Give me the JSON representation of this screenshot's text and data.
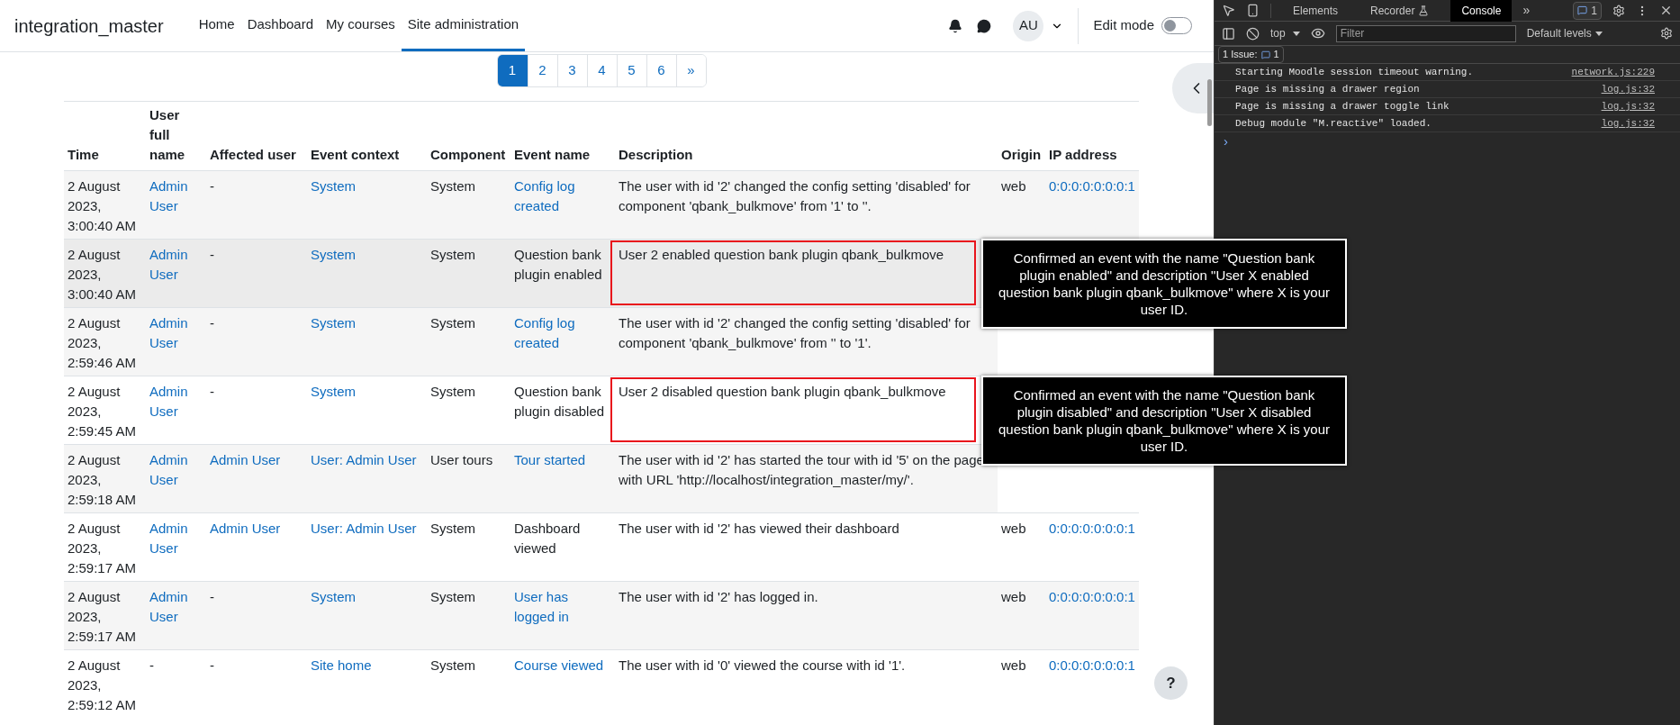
{
  "navbar": {
    "brand": "integration_master",
    "links": [
      {
        "label": "Home",
        "selected": false
      },
      {
        "label": "Dashboard",
        "selected": false
      },
      {
        "label": "My courses",
        "selected": false
      },
      {
        "label": "Site administration",
        "selected": true
      }
    ],
    "avatar": "AU",
    "edit_mode": {
      "label": "Edit mode",
      "on": false
    }
  },
  "pagination": [
    {
      "label": "1",
      "selected": true
    },
    {
      "label": "2",
      "selected": false
    },
    {
      "label": "3",
      "selected": false
    },
    {
      "label": "4",
      "selected": false
    },
    {
      "label": "5",
      "selected": false
    },
    {
      "label": "6",
      "selected": false
    },
    {
      "label": "»",
      "selected": false
    }
  ],
  "table": {
    "columns": [
      "Time",
      "User full name",
      "Affected user",
      "Event context",
      "Component",
      "Event name",
      "Description",
      "Origin",
      "IP address"
    ],
    "rows": [
      {
        "highlighted": false,
        "cells": [
          {
            "text": "2 August 2023, 3:00:40 AM",
            "link": false
          },
          {
            "text": "Admin User",
            "link": true
          },
          {
            "text": "-",
            "link": false
          },
          {
            "text": "System",
            "link": true
          },
          {
            "text": "System",
            "link": false
          },
          {
            "text": "Config log created",
            "link": true
          },
          {
            "text": "The user with id '2' changed the config setting 'disabled' for component 'qbank_bulkmove' from '1' to ''.",
            "link": false
          },
          {
            "text": "web",
            "link": false
          },
          {
            "text": "0:0:0:0:0:0:0:1",
            "link": true
          }
        ]
      },
      {
        "highlighted": true,
        "outlined": true,
        "callout": "Confirmed an event with the name \"Question bank plugin enabled\" and description \"User X enabled question bank plugin qbank_bulkmove\" where X is your user ID.",
        "cells": [
          {
            "text": "2 August 2023, 3:00:40 AM",
            "link": false
          },
          {
            "text": "Admin User",
            "link": true
          },
          {
            "text": "-",
            "link": false
          },
          {
            "text": "System",
            "link": true
          },
          {
            "text": "System",
            "link": false
          },
          {
            "text": "Question bank plugin enabled",
            "link": false
          },
          {
            "text": "User 2 enabled question bank plugin qbank_bulkmove",
            "link": false
          }
        ]
      },
      {
        "highlighted": false,
        "cells": [
          {
            "text": "2 August 2023, 2:59:46 AM",
            "link": false
          },
          {
            "text": "Admin User",
            "link": true
          },
          {
            "text": "-",
            "link": false
          },
          {
            "text": "System",
            "link": true
          },
          {
            "text": "System",
            "link": false
          },
          {
            "text": "Config log created",
            "link": true
          },
          {
            "text": "The user with id '2' changed the config setting 'disabled' for component 'qbank_bulkmove' from '' to '1'.",
            "link": false
          }
        ]
      },
      {
        "highlighted": false,
        "outlined": true,
        "callout": "Confirmed an event with the name \"Question bank plugin disabled\" and description \"User X disabled question bank plugin qbank_bulkmove\" where X is your user ID.",
        "cells": [
          {
            "text": "2 August 2023, 2:59:45 AM",
            "link": false
          },
          {
            "text": "Admin User",
            "link": true
          },
          {
            "text": "-",
            "link": false
          },
          {
            "text": "System",
            "link": true
          },
          {
            "text": "System",
            "link": false
          },
          {
            "text": "Question bank plugin disabled",
            "link": false
          },
          {
            "text": "User 2 disabled question bank plugin qbank_bulkmove",
            "link": false
          }
        ]
      },
      {
        "highlighted": false,
        "cells": [
          {
            "text": "2 August 2023, 2:59:18 AM",
            "link": false
          },
          {
            "text": "Admin User",
            "link": true
          },
          {
            "text": "Admin User",
            "link": true
          },
          {
            "text": "User: Admin User",
            "link": true
          },
          {
            "text": "User tours",
            "link": false
          },
          {
            "text": "Tour started",
            "link": true
          },
          {
            "text": "The user with id '2' has started the tour with id '5' on the page with URL 'http://localhost/integration_master/my/'.",
            "link": false
          }
        ]
      },
      {
        "highlighted": false,
        "cells": [
          {
            "text": "2 August 2023, 2:59:17 AM",
            "link": false
          },
          {
            "text": "Admin User",
            "link": true
          },
          {
            "text": "Admin User",
            "link": true
          },
          {
            "text": "User: Admin User",
            "link": true
          },
          {
            "text": "System",
            "link": false
          },
          {
            "text": "Dashboard viewed",
            "link": false
          },
          {
            "text": "The user with id '2' has viewed their dashboard",
            "link": false
          },
          {
            "text": "web",
            "link": false
          },
          {
            "text": "0:0:0:0:0:0:0:1",
            "link": true
          }
        ]
      },
      {
        "highlighted": false,
        "cells": [
          {
            "text": "2 August 2023, 2:59:17 AM",
            "link": false
          },
          {
            "text": "Admin User",
            "link": true
          },
          {
            "text": "-",
            "link": false
          },
          {
            "text": "System",
            "link": true
          },
          {
            "text": "System",
            "link": false
          },
          {
            "text": "User has logged in",
            "link": true
          },
          {
            "text": "The user with id '2' has logged in.",
            "link": false
          },
          {
            "text": "web",
            "link": false
          },
          {
            "text": "0:0:0:0:0:0:0:1",
            "link": true
          }
        ]
      },
      {
        "highlighted": false,
        "cells": [
          {
            "text": "2 August 2023, 2:59:12 AM",
            "link": false
          },
          {
            "text": "-",
            "link": false
          },
          {
            "text": "-",
            "link": false
          },
          {
            "text": "Site home",
            "link": true
          },
          {
            "text": "System",
            "link": false
          },
          {
            "text": "Course viewed",
            "link": true
          },
          {
            "text": "The user with id '0' viewed the course with id '1'.",
            "link": false
          },
          {
            "text": "web",
            "link": false
          },
          {
            "text": "0:0:0:0:0:0:0:1",
            "link": true
          }
        ]
      }
    ]
  },
  "help_button": "?",
  "devtools": {
    "tabs": [
      {
        "label": "Elements",
        "selected": false
      },
      {
        "label": "Recorder",
        "selected": false
      },
      {
        "label": "Console",
        "selected": true
      }
    ],
    "more": "»",
    "issues_count": "1",
    "context": "top",
    "filter_placeholder": "Filter",
    "levels": "Default levels",
    "issues_label": "1 Issue:",
    "issues_badge": "1",
    "messages": [
      {
        "text": "Starting Moodle session timeout warning.",
        "source": "network.js:229"
      },
      {
        "text": "Page is missing a drawer region",
        "source": "log.js:32"
      },
      {
        "text": "Page is missing a drawer toggle link",
        "source": "log.js:32"
      },
      {
        "text": "Debug module \"M.reactive\" loaded.",
        "source": "log.js:32"
      }
    ],
    "prompt": "›"
  }
}
